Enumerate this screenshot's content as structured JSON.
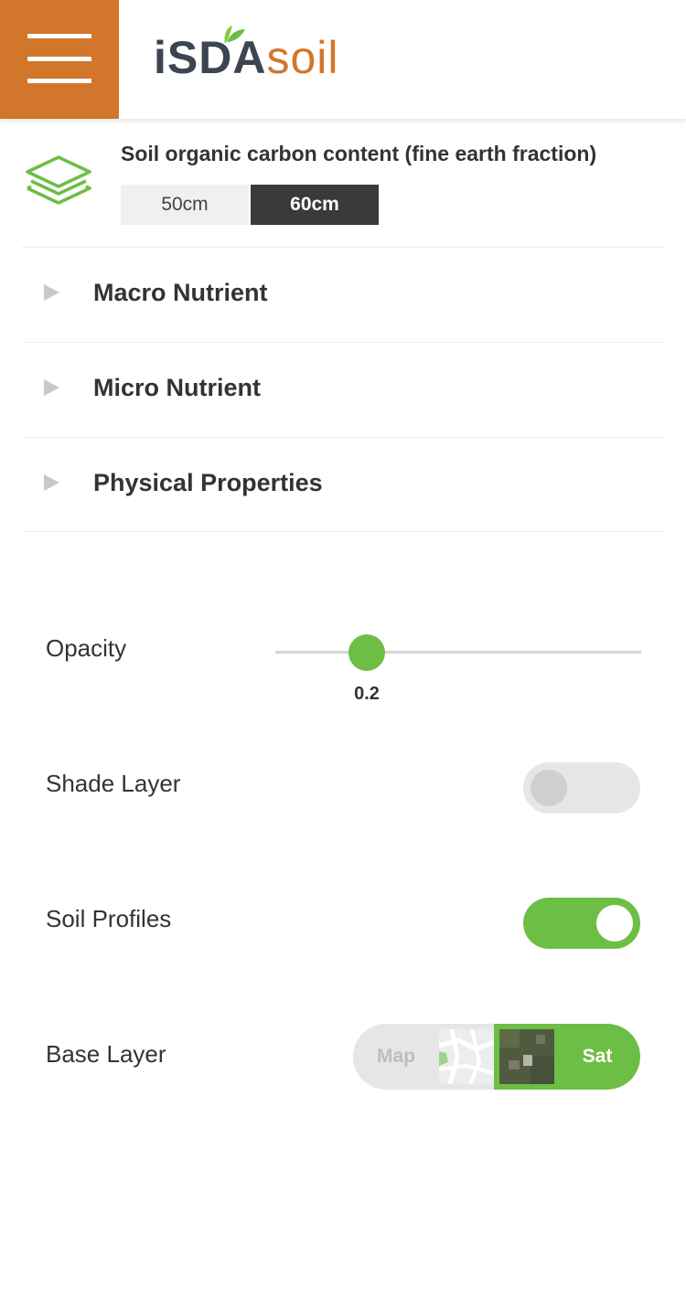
{
  "header": {
    "logo_part1": "iSDA",
    "logo_part2": "soil",
    "menu_icon": "hamburger-menu-icon"
  },
  "layer": {
    "icon": "layers-icon",
    "title": "Soil organic carbon content (fine earth fraction)",
    "depths": [
      "50cm",
      "60cm"
    ],
    "selected_depth": "60cm"
  },
  "accordion": [
    {
      "label": "Macro Nutrient",
      "icon": "caret-right-icon"
    },
    {
      "label": "Micro Nutrient",
      "icon": "caret-right-icon"
    },
    {
      "label": "Physical Properties",
      "icon": "caret-right-icon"
    }
  ],
  "settings": {
    "opacity": {
      "label": "Opacity",
      "value": "0.2",
      "fraction": 0.2
    },
    "shade_layer": {
      "label": "Shade Layer",
      "on": false
    },
    "soil_profiles": {
      "label": "Soil Profiles",
      "on": true
    },
    "base_layer": {
      "label": "Base Layer",
      "options": [
        "Map",
        "Sat"
      ],
      "selected": "Sat"
    }
  },
  "colors": {
    "brand_orange": "#D2762B",
    "accent_green": "#6DBE45",
    "dark": "#3A3A3A"
  }
}
